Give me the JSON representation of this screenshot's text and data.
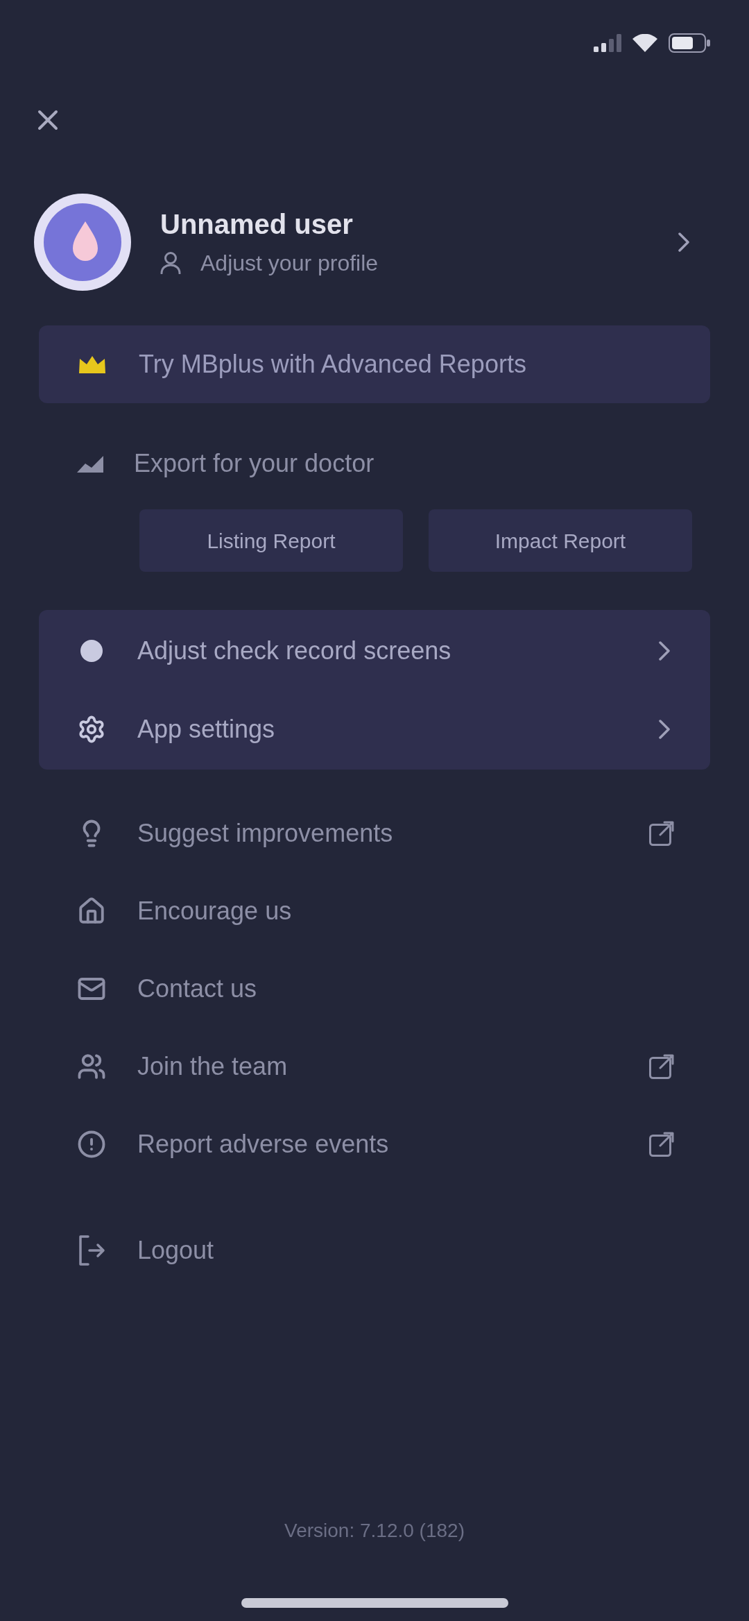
{
  "profile": {
    "name": "Unnamed user",
    "link": "Adjust your profile"
  },
  "promo_banner": {
    "text": "Try MBplus with Advanced Reports"
  },
  "export": {
    "title": "Export for your doctor",
    "buttons": [
      "Listing Report",
      "Impact Report"
    ]
  },
  "settings_menu": [
    {
      "label": "Adjust check record screens"
    },
    {
      "label": "App settings"
    }
  ],
  "links": [
    {
      "label": "Suggest improvements",
      "kind": "external"
    },
    {
      "label": "Encourage us",
      "kind": "internal"
    },
    {
      "label": "Contact us",
      "kind": "internal"
    },
    {
      "label": "Join the team",
      "kind": "external"
    },
    {
      "label": "Report adverse events",
      "kind": "external"
    }
  ],
  "logout": {
    "label": "Logout"
  },
  "version": "Version: 7.12.0 (182)"
}
